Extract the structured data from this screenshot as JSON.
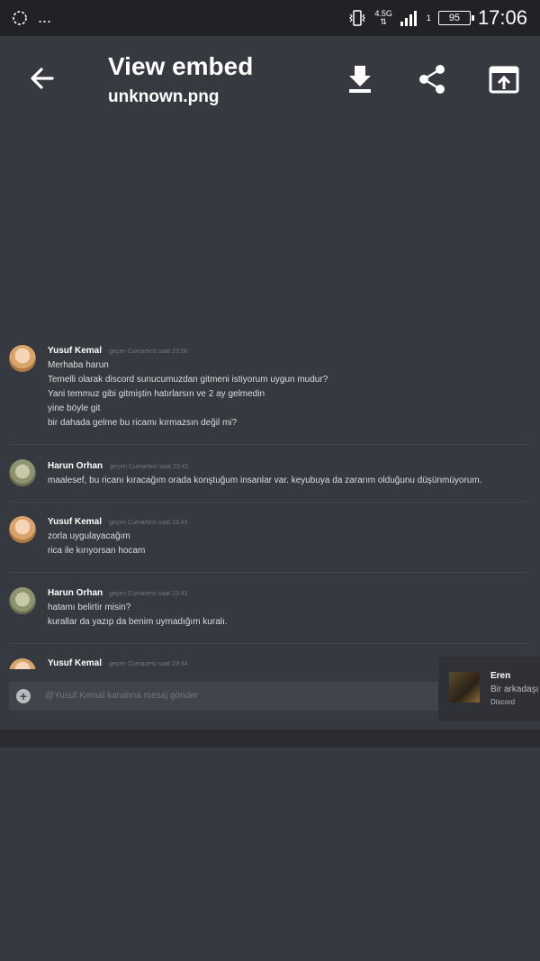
{
  "status_bar": {
    "time": "17:06",
    "battery": "95",
    "network": "4.5G",
    "sim_slot": "1",
    "dots": "..."
  },
  "header": {
    "title": "View embed",
    "subtitle": "unknown.png",
    "icons": [
      "back-arrow-icon",
      "download-icon",
      "share-icon",
      "open-external-icon"
    ]
  },
  "chat": {
    "messages": [
      {
        "author": "Yusuf Kemal",
        "timestamp": "geçen Cumartesi saat 23:08",
        "lines": [
          "Merhaba harun",
          "Temelli olarak discord sunucumuzdan gitmeni istiyorum uygun mudur?",
          "Yani temmuz gibi gitmiştin hatırlarsın ve 2 ay gelmedin",
          "yine böyle git",
          "bir dahada gelme bu ricamı kırmazsın değil mi?"
        ]
      },
      {
        "author": "Harun Orhan",
        "timestamp": "geçen Cumartesi saat 23:42",
        "lines": [
          "maalesef, bu ricanı kıracağım orada konştuğum insanlar var. keyubuya da zararım olduğunu düşünmüyorum."
        ]
      },
      {
        "author": "Yusuf Kemal",
        "timestamp": "geçen Cumartesi saat 23:43",
        "lines": [
          "zorla uygulayacağım",
          "rica ile kırıyorsan hocam"
        ]
      },
      {
        "author": "Harun Orhan",
        "timestamp": "geçen Cumartesi saat 23:43",
        "lines": [
          "hatamı belirtir misin?",
          "kurallar da yazıp da benim uymadığım kuralı."
        ]
      },
      {
        "author": "Yusuf Kemal",
        "timestamp": "geçen Cumartesi saat 23:44",
        "lines": []
      }
    ],
    "compose_placeholder": "@Yusuf Kemal kanalına mesaj gönder"
  },
  "notification": {
    "name": "Eren",
    "text": "Bir arkadaşı",
    "app": "Discord"
  },
  "colors": {
    "background": "#36393f",
    "status_bar": "#202225",
    "text_primary": "#ffffff",
    "text_muted": "#72767d"
  }
}
